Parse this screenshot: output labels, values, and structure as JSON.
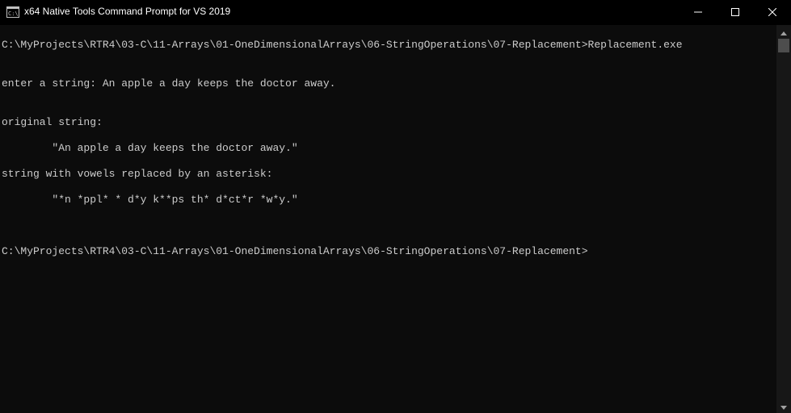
{
  "window": {
    "title": "x64 Native Tools Command Prompt for VS 2019",
    "icon": "cmd-icon",
    "controls": {
      "minimize_icon": "minimize-icon",
      "maximize_icon": "maximize-icon",
      "close_icon": "close-icon"
    }
  },
  "console": {
    "lines": [
      "C:\\MyProjects\\RTR4\\03-C\\11-Arrays\\01-OneDimensionalArrays\\06-StringOperations\\07-Replacement>Replacement.exe",
      "enter a string: An apple a day keeps the doctor away.",
      "original string:",
      "        \"An apple a day keeps the doctor away.\"",
      "string with vowels replaced by an asterisk:",
      "        \"*n *ppl* * d*y k**ps th* d*ct*r *w*y.\"",
      "C:\\MyProjects\\RTR4\\03-C\\11-Arrays\\01-OneDimensionalArrays\\06-StringOperations\\07-Replacement>"
    ]
  },
  "colors": {
    "background": "#0c0c0c",
    "text": "#cccccc",
    "titlebar": "#000000",
    "title_text": "#ffffff"
  }
}
